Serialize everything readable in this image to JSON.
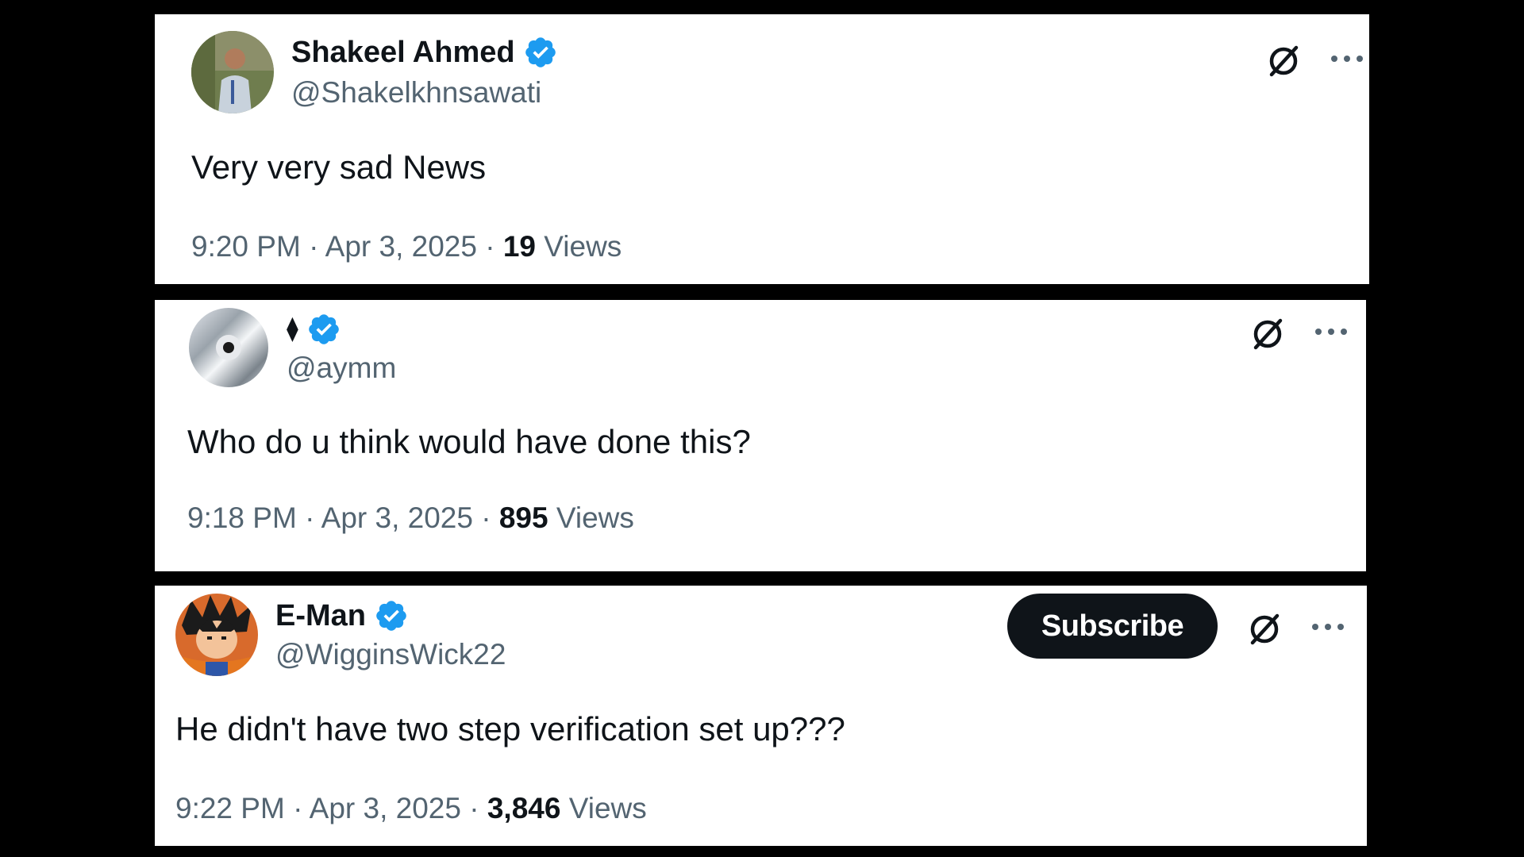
{
  "tweets": [
    {
      "name": "Shakeel Ahmed",
      "handle": "@Shakelkhnsawati",
      "text": "Very very sad News",
      "time": "9:20 PM",
      "date": "Apr 3, 2025",
      "views_count": "19",
      "views_label": "Views",
      "verified": true,
      "avatar_icon": "person-photo-icon"
    },
    {
      "name": "⧫",
      "handle": "@aymm",
      "text": "Who do u think would have done this?",
      "time": "9:18 PM",
      "date": "Apr 3, 2025",
      "views_count": "895",
      "views_label": "Views",
      "verified": true,
      "avatar_icon": "compact-disc-icon"
    },
    {
      "name": "E-Man",
      "handle": "@WigginsWick22",
      "text": "He didn't have two step verification set up???",
      "time": "9:22 PM",
      "date": "Apr 3, 2025",
      "views_count": "3,846",
      "views_label": "Views",
      "verified": true,
      "avatar_icon": "anime-character-icon",
      "subscribe_label": "Subscribe"
    }
  ],
  "separator": " · ",
  "colors": {
    "background": "#000000",
    "card": "#ffffff",
    "primary_text": "#0f1419",
    "secondary_text": "#536471",
    "verified_blue": "#1d9bf0",
    "subscribe_bg": "#0f1419"
  }
}
